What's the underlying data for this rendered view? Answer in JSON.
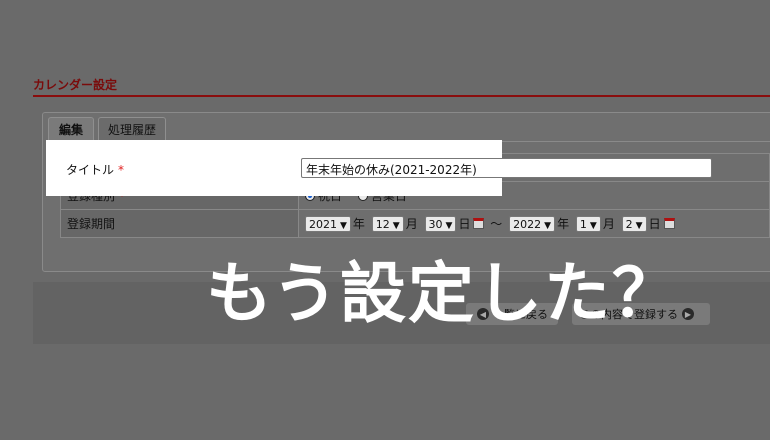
{
  "section_title": "カレンダー設定",
  "tabs": [
    {
      "label": "編集",
      "active": true
    },
    {
      "label": "処理履歴",
      "active": false
    }
  ],
  "form": {
    "title_label": "タイトル",
    "title_value": "年末年始の休み(2021-2022年)",
    "type_label": "登録種別",
    "type_options": [
      "祝日",
      "営業日"
    ],
    "type_selected": "祝日",
    "period_label": "登録期間",
    "required_mark": "*",
    "start": {
      "year": "2021",
      "month": "12",
      "day": "30"
    },
    "end": {
      "year": "2022",
      "month": "1",
      "day": "2"
    },
    "unit_year": "年",
    "unit_month": "月",
    "unit_day": "日",
    "range_sep": "〜"
  },
  "buttons": {
    "back_label": "一覧に戻る",
    "register_label": "この内容で登録する"
  },
  "overlay_text": "もう設定した？",
  "colors": {
    "accent": "#8a0d0d",
    "required": "#c01818",
    "radio_on": "#1a5fd1"
  }
}
